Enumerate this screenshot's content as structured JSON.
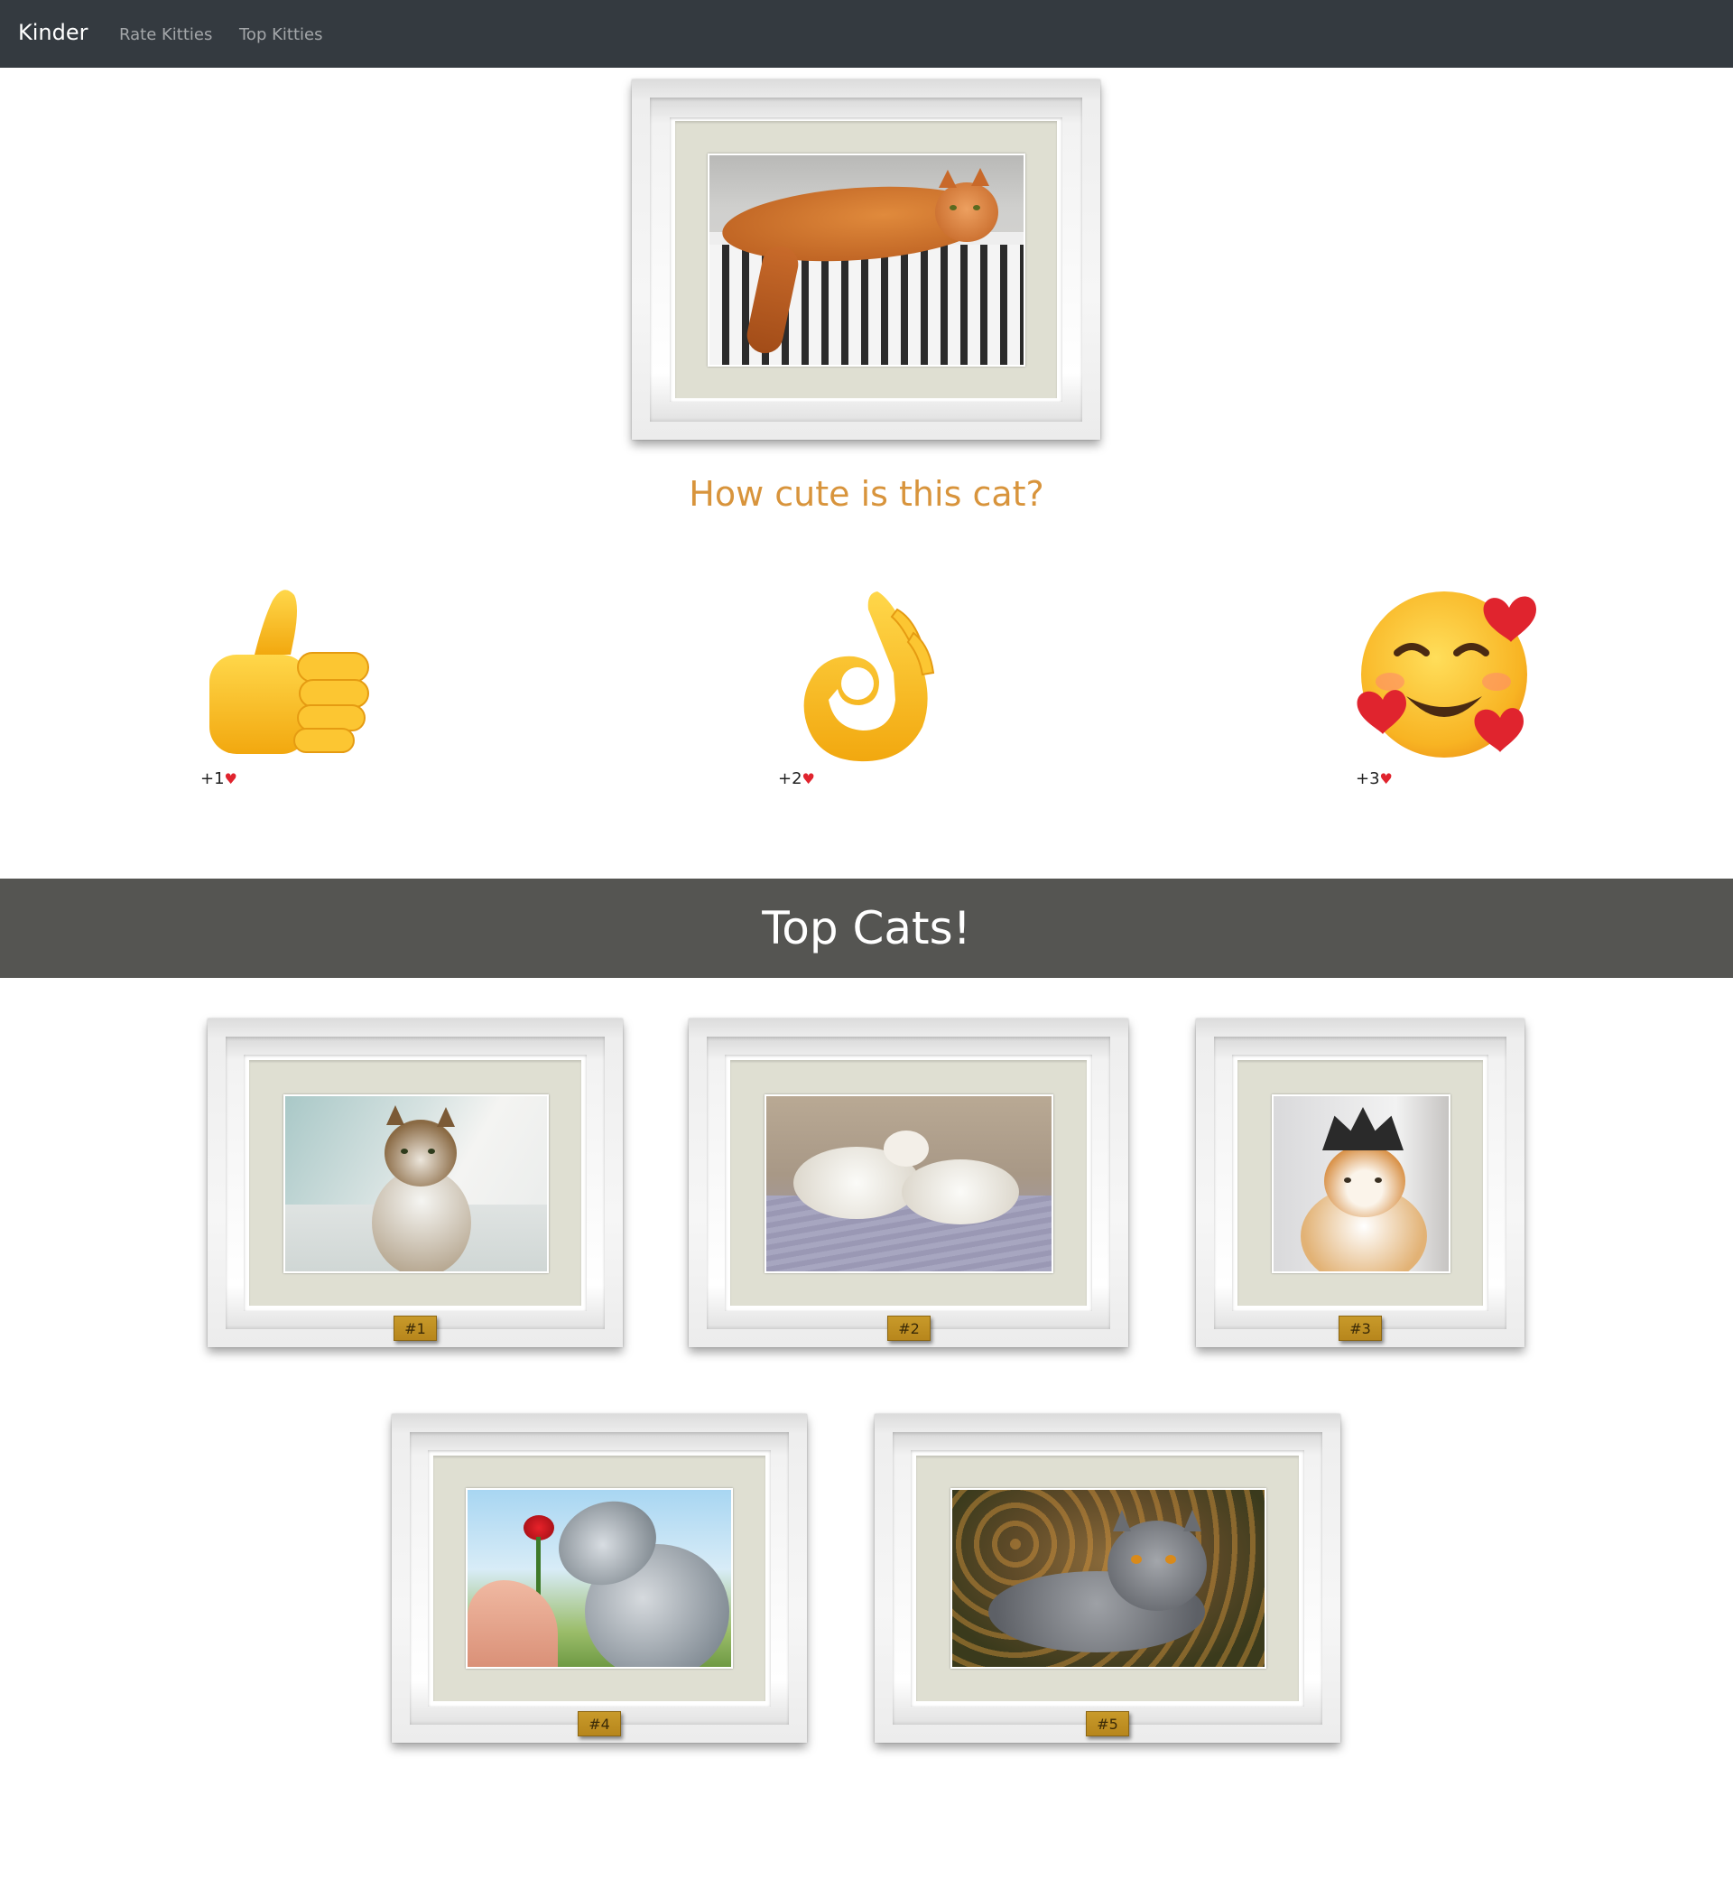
{
  "navbar": {
    "brand": "Kinder",
    "links": [
      "Rate Kitties",
      "Top Kitties"
    ]
  },
  "rate": {
    "question": "How cute is this cat?",
    "options": [
      {
        "label": "+1",
        "icon": "thumbs-up-icon"
      },
      {
        "label": "+2",
        "icon": "ok-hand-icon"
      },
      {
        "label": "+3",
        "icon": "smiling-face-with-hearts-icon"
      }
    ],
    "heart_color": "#e0242e"
  },
  "top": {
    "title": "Top Cats!",
    "ranks": [
      "#1",
      "#2",
      "#3",
      "#4",
      "#5"
    ]
  },
  "colors": {
    "navbar_bg": "#343a40",
    "question_color": "#d8943c",
    "banner_bg": "#555552",
    "plaque": "#c89a2a",
    "mat": "#dfdfd2"
  }
}
